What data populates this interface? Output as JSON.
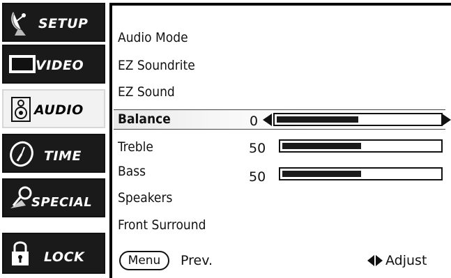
{
  "sidebar": {
    "tabs": [
      {
        "label": "SETUP",
        "icon": "satellite-dish-icon",
        "active": false
      },
      {
        "label": "VIDEO",
        "icon": "tv-screen-icon",
        "active": false
      },
      {
        "label": "AUDIO",
        "icon": "speaker-icon",
        "active": true
      },
      {
        "label": "TIME",
        "icon": "clock-icon",
        "active": false
      },
      {
        "label": "SPECIAL",
        "icon": "magnifier-icon",
        "active": false
      },
      {
        "label": "LOCK",
        "icon": "padlock-icon",
        "active": false
      }
    ]
  },
  "menu": {
    "items": [
      {
        "label": "Audio Mode"
      },
      {
        "label": "EZ Soundrite"
      },
      {
        "label": "EZ Sound"
      },
      {
        "label": "Balance",
        "value": "0",
        "selected": true
      },
      {
        "label": "Treble",
        "value": "50"
      },
      {
        "label": "Bass",
        "value": "50"
      },
      {
        "label": "Speakers"
      },
      {
        "label": "Front Surround"
      }
    ],
    "levels": {
      "balance": 0.5,
      "treble": 0.5,
      "bass": 0.5
    }
  },
  "footer": {
    "menu_button": "Menu",
    "prev_label": "Prev.",
    "adjust_label": "Adjust"
  },
  "colors": {
    "dark": "#1a1a1a",
    "active_tab": "#f2f2f2"
  }
}
